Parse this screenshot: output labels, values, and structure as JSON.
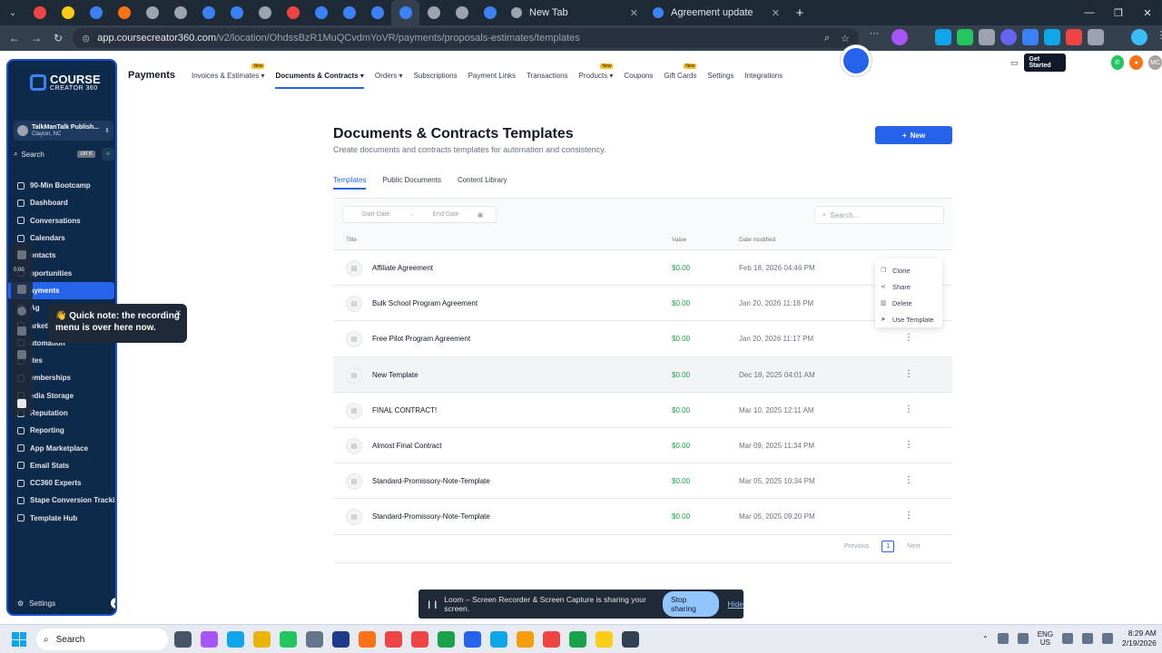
{
  "browser": {
    "tabs": [
      {
        "label": "New Tab",
        "close": "✕"
      },
      {
        "label": "Agreement update",
        "close": "✕"
      }
    ],
    "new_tab_symbol": "+",
    "url_host": "app.coursecreator360.com",
    "url_path": "/v2/location/OhdssBzR1MuQCvdmYoVR/payments/proposals-estimates/templates",
    "icon_colors": [
      "#ef4444",
      "#facc15",
      "#3b82f6",
      "#f97316",
      "#9ca3af",
      "#9ca3af",
      "#3b82f6",
      "#3b82f6",
      "#9ca3af",
      "#ef4444",
      "#3b82f6",
      "#3b82f6",
      "#3b82f6",
      "#3b82f6",
      "#9ca3af",
      "#9ca3af",
      "#3b82f6"
    ]
  },
  "sidebar": {
    "logo_line1": "COURSE",
    "logo_line2": "CREATOR 360",
    "account_name": "TalkManTalk Publish...",
    "account_location": "Clayton, NC",
    "search_label": "Search",
    "search_kbd": "ctrl K",
    "add_symbol": "+",
    "items": [
      {
        "label": "90-Min Bootcamp",
        "active": false
      },
      {
        "label": "Dashboard",
        "active": false
      },
      {
        "label": "Conversations",
        "active": false
      },
      {
        "label": "Calendars",
        "active": false
      },
      {
        "label": "ontacts",
        "active": false
      },
      {
        "label": "pportunities",
        "active": false
      },
      {
        "label": "ayments",
        "active": true
      },
      {
        "label": "Ag",
        "active": false
      },
      {
        "label": "arketing",
        "active": false
      },
      {
        "label": "utomation",
        "active": false
      },
      {
        "label": "ites",
        "active": false
      },
      {
        "label": "emberships",
        "active": false
      },
      {
        "label": "edia Storage",
        "active": false
      },
      {
        "label": "Reputation",
        "active": false
      },
      {
        "label": "Reporting",
        "active": false
      },
      {
        "label": "App Marketplace",
        "active": false
      },
      {
        "label": "Email Stats",
        "active": false
      },
      {
        "label": "CC360 Experts",
        "active": false
      },
      {
        "label": "Stape Conversion Tracki...",
        "active": false
      },
      {
        "label": "Template Hub",
        "active": false
      }
    ],
    "settings_label": "Settings"
  },
  "recorder": {
    "time": "0:00",
    "tooltip": "👋 Quick note: the recording menu is over here now.",
    "tooltip_close": "✕"
  },
  "topnav": {
    "brand": "Payments",
    "items": [
      {
        "label": "Invoices & Estimates ▾",
        "badge": "New",
        "active": false
      },
      {
        "label": "Documents & Contracts ▾",
        "badge": "",
        "active": true
      },
      {
        "label": "Orders ▾",
        "badge": "",
        "active": false
      },
      {
        "label": "Subscriptions",
        "badge": "",
        "active": false
      },
      {
        "label": "Payment Links",
        "badge": "",
        "active": false
      },
      {
        "label": "Transactions",
        "badge": "",
        "active": false
      },
      {
        "label": "Products ▾",
        "badge": "New",
        "active": false
      },
      {
        "label": "Coupons",
        "badge": "",
        "active": false
      },
      {
        "label": "Gift Cards",
        "badge": "New",
        "active": false
      },
      {
        "label": "Settings",
        "badge": "",
        "active": false
      },
      {
        "label": "Integrations",
        "badge": "",
        "active": false
      }
    ],
    "get_started": "Get Started",
    "avatar_initials": "MC"
  },
  "page": {
    "title": "Documents & Contracts Templates",
    "subtitle": "Create documents and contracts templates for automation and consistency.",
    "new_button": "New",
    "tabs": [
      "Templates",
      "Public Documents",
      "Content Library"
    ],
    "start_date_placeholder": "Start Date",
    "end_date_placeholder": "End Date",
    "search_placeholder": "Search...",
    "columns": {
      "title": "Title",
      "value": "Value",
      "date": "Date modified"
    },
    "rows": [
      {
        "title": "Affiliate Agreement",
        "value": "$0.00",
        "date": "Feb 18, 2026 04:46 PM"
      },
      {
        "title": "Bulk School Program Agreement",
        "value": "$0.00",
        "date": "Jan 20, 2026 11:18 PM"
      },
      {
        "title": "Free Pilot Program Agreement",
        "value": "$0.00",
        "date": "Jan 20, 2026 11:17 PM"
      },
      {
        "title": "New Template",
        "value": "$0.00",
        "date": "Dec 18, 2025 04:01 AM"
      },
      {
        "title": "FINAL CONTRACT!",
        "value": "$0.00",
        "date": "Mar 10, 2025 12:11 AM"
      },
      {
        "title": "Almost Final Contract",
        "value": "$0.00",
        "date": "Mar 09, 2025 11:34 PM"
      },
      {
        "title": "Standard-Promissory-Note-Template",
        "value": "$0.00",
        "date": "Mar 05, 2025 10:34 PM"
      },
      {
        "title": "Standard-Promissory-Note-Template",
        "value": "$0.00",
        "date": "Mar 05, 2025 09:20 PM"
      }
    ],
    "context_menu": [
      "Clone",
      "Share",
      "Delete",
      "Use Template"
    ],
    "pager": {
      "previous": "Previous",
      "page": "1",
      "next": "Next"
    }
  },
  "loom": {
    "message": "Loom – Screen Recorder & Screen Capture is sharing your screen.",
    "stop": "Stop sharing",
    "hide": "Hide"
  },
  "taskbar": {
    "search": "Search",
    "lang1": "ENG",
    "lang2": "US",
    "time": "8:29 AM",
    "date": "2/19/2026"
  },
  "colors": {
    "accent": "#2563eb",
    "sidebar": "#0e2a4a",
    "money": "#16a34a"
  }
}
